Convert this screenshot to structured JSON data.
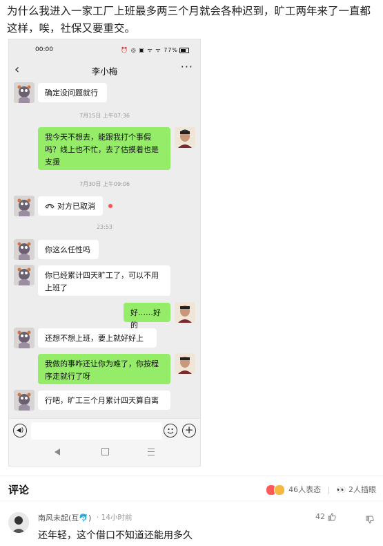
{
  "post": {
    "text": "为什么我进入一家工厂上班最多两三个月就会各种迟到，旷工两年来了一直都这样，唉，社保又要重交。"
  },
  "phone": {
    "status": {
      "time": "00:00",
      "battery": "77%",
      "signal_text": "⏰ 🔕 ▣ ᵢₗ ᵢₗ 77%"
    },
    "chat_title": "李小梅",
    "back_icon": "chevron-left-icon",
    "more_label": "···",
    "messages": [
      {
        "side": "in",
        "text": "确定没问题就行"
      },
      {
        "type": "time",
        "text": "7月15日 上午07:36"
      },
      {
        "side": "out",
        "text": "我今天不想去，能跟我打个事假吗？线上也不忙，去了估摸着也是支援"
      },
      {
        "type": "time",
        "text": "7月30日 上午09:06"
      },
      {
        "side": "in",
        "text": "对方已取消",
        "call": true,
        "icon": "phone-hangup-icon"
      },
      {
        "type": "time",
        "text": "23:53"
      },
      {
        "side": "in",
        "text": "你这么任性吗"
      },
      {
        "side": "in",
        "text": "你已经累计四天旷工了，可以不用上班了"
      },
      {
        "side": "out",
        "text": "好……好的"
      },
      {
        "side": "in",
        "text": "还想不想上班，要上就好好上"
      },
      {
        "side": "out",
        "text": "我做的事咋还让你为难了，你按程序走就行了呀"
      },
      {
        "side": "in",
        "text": "行吧，旷工三个月累计四天算自离"
      }
    ],
    "input_icons": [
      "voice-icon",
      "emoji-icon",
      "plus-icon"
    ]
  },
  "comments": {
    "title": "评论",
    "reactions_label": "46人表态",
    "collect_label": "2人插眼",
    "items": [
      {
        "user": "南风未起(互🐬)",
        "time": "· 14小时前",
        "likes": "42",
        "text": "还年轻，这个借口不知道还能用多久"
      }
    ]
  }
}
